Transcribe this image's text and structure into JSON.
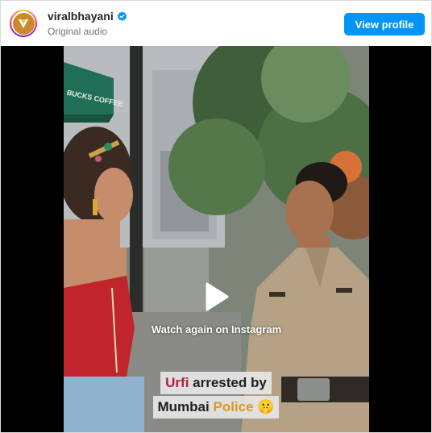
{
  "header": {
    "username": "viralbhayani",
    "subtitle": "Original audio",
    "view_profile_label": "View profile",
    "avatar_icon": "viralbhayani-logo-icon",
    "verified_icon": "verified-badge-icon"
  },
  "video": {
    "watch_again_label": "Watch again on Instagram",
    "play_icon": "play-icon",
    "shop_sign_text": "BUCKS COFFEE",
    "caption_line1_highlight": "Urfi",
    "caption_line1_rest": " arrested by",
    "caption_line2_main": "Mumbai ",
    "caption_line2_highlight": "Police",
    "caption_emoji": "🤫"
  },
  "colors": {
    "button_blue": "#0095f6",
    "caption_red": "#b8203a",
    "caption_gold": "#d99a1c"
  }
}
